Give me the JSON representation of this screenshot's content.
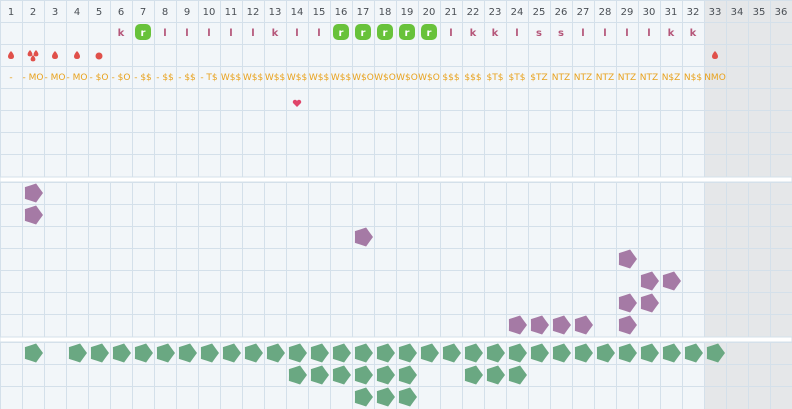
{
  "columns": [
    "1",
    "2",
    "3",
    "4",
    "5",
    "6",
    "7",
    "8",
    "9",
    "10",
    "11",
    "12",
    "13",
    "14",
    "15",
    "16",
    "17",
    "18",
    "19",
    "20",
    "21",
    "22",
    "23",
    "24",
    "25",
    "26",
    "27",
    "28",
    "29",
    "30",
    "31",
    "32",
    "33",
    "34",
    "35",
    "36"
  ],
  "letter_row": [
    {
      "col": 6,
      "text": "k"
    },
    {
      "col": 7,
      "text": "r",
      "badge": true
    },
    {
      "col": 8,
      "text": "l"
    },
    {
      "col": 9,
      "text": "l"
    },
    {
      "col": 10,
      "text": "l"
    },
    {
      "col": 11,
      "text": "l"
    },
    {
      "col": 12,
      "text": "l"
    },
    {
      "col": 13,
      "text": "k"
    },
    {
      "col": 14,
      "text": "l"
    },
    {
      "col": 15,
      "text": "l"
    },
    {
      "col": 16,
      "text": "r",
      "badge": true
    },
    {
      "col": 17,
      "text": "r",
      "badge": true
    },
    {
      "col": 18,
      "text": "r",
      "badge": true
    },
    {
      "col": 19,
      "text": "r",
      "badge": true
    },
    {
      "col": 20,
      "text": "r",
      "badge": true
    },
    {
      "col": 21,
      "text": "l"
    },
    {
      "col": 22,
      "text": "k"
    },
    {
      "col": 23,
      "text": "k"
    },
    {
      "col": 24,
      "text": "l"
    },
    {
      "col": 25,
      "text": "s"
    },
    {
      "col": 26,
      "text": "s"
    },
    {
      "col": 27,
      "text": "l"
    },
    {
      "col": 28,
      "text": "l"
    },
    {
      "col": 29,
      "text": "l"
    },
    {
      "col": 30,
      "text": "l"
    },
    {
      "col": 31,
      "text": "k"
    },
    {
      "col": 32,
      "text": "k"
    }
  ],
  "drop_row": [
    {
      "col": 1,
      "icon": "drop-icon"
    },
    {
      "col": 2,
      "icon": "double-drop-icon"
    },
    {
      "col": 3,
      "icon": "drop-icon"
    },
    {
      "col": 4,
      "icon": "drop-icon"
    },
    {
      "col": 5,
      "icon": "dot-icon"
    },
    {
      "col": 33,
      "icon": "drop-icon"
    }
  ],
  "code_row": [
    {
      "col": 1,
      "text": "-"
    },
    {
      "col": 2,
      "text": "- MO"
    },
    {
      "col": 3,
      "text": "- MO"
    },
    {
      "col": 4,
      "text": "- MO"
    },
    {
      "col": 5,
      "text": "- $O"
    },
    {
      "col": 6,
      "text": "- $O"
    },
    {
      "col": 7,
      "text": "- $$"
    },
    {
      "col": 8,
      "text": "- $$"
    },
    {
      "col": 9,
      "text": "- $$"
    },
    {
      "col": 10,
      "text": "- T$"
    },
    {
      "col": 11,
      "text": "W$$"
    },
    {
      "col": 12,
      "text": "W$$"
    },
    {
      "col": 13,
      "text": "W$$"
    },
    {
      "col": 14,
      "text": "W$$"
    },
    {
      "col": 15,
      "text": "W$$"
    },
    {
      "col": 16,
      "text": "W$$"
    },
    {
      "col": 17,
      "text": "W$O"
    },
    {
      "col": 18,
      "text": "W$O"
    },
    {
      "col": 19,
      "text": "W$O"
    },
    {
      "col": 20,
      "text": "W$O"
    },
    {
      "col": 21,
      "text": "$$$"
    },
    {
      "col": 22,
      "text": "$$$"
    },
    {
      "col": 23,
      "text": "$T$"
    },
    {
      "col": 24,
      "text": "$T$"
    },
    {
      "col": 25,
      "text": "$TZ"
    },
    {
      "col": 26,
      "text": "NTZ"
    },
    {
      "col": 27,
      "text": "NTZ"
    },
    {
      "col": 28,
      "text": "NTZ"
    },
    {
      "col": 29,
      "text": "NTZ"
    },
    {
      "col": 30,
      "text": "NTZ"
    },
    {
      "col": 31,
      "text": "N$Z"
    },
    {
      "col": 32,
      "text": "N$$"
    },
    {
      "col": 33,
      "text": "NMO"
    }
  ],
  "heart": {
    "col": 14
  },
  "purple_blobs": [
    [
      2,
      0
    ],
    [
      2,
      1
    ],
    [
      17,
      2
    ],
    [
      29,
      3
    ],
    [
      30,
      4
    ],
    [
      31,
      4
    ],
    [
      29,
      5
    ],
    [
      30,
      5
    ],
    [
      24,
      6
    ],
    [
      25,
      6
    ],
    [
      26,
      6
    ],
    [
      27,
      6
    ],
    [
      29,
      6
    ]
  ],
  "green_blobs": [
    [
      2,
      0
    ],
    [
      4,
      0
    ],
    [
      5,
      0
    ],
    [
      6,
      0
    ],
    [
      7,
      0
    ],
    [
      8,
      0
    ],
    [
      9,
      0
    ],
    [
      10,
      0
    ],
    [
      11,
      0
    ],
    [
      12,
      0
    ],
    [
      13,
      0
    ],
    [
      14,
      0
    ],
    [
      15,
      0
    ],
    [
      16,
      0
    ],
    [
      17,
      0
    ],
    [
      18,
      0
    ],
    [
      19,
      0
    ],
    [
      20,
      0
    ],
    [
      21,
      0
    ],
    [
      22,
      0
    ],
    [
      23,
      0
    ],
    [
      24,
      0
    ],
    [
      25,
      0
    ],
    [
      26,
      0
    ],
    [
      27,
      0
    ],
    [
      28,
      0
    ],
    [
      29,
      0
    ],
    [
      30,
      0
    ],
    [
      31,
      0
    ],
    [
      32,
      0
    ],
    [
      33,
      0
    ],
    [
      14,
      1
    ],
    [
      15,
      1
    ],
    [
      16,
      1
    ],
    [
      17,
      1
    ],
    [
      18,
      1
    ],
    [
      19,
      1
    ],
    [
      22,
      1
    ],
    [
      23,
      1
    ],
    [
      24,
      1
    ],
    [
      17,
      2
    ],
    [
      18,
      2
    ],
    [
      19,
      2
    ]
  ],
  "colors": {
    "background": "#f2f6f9",
    "grid_line": "#d4e0ea",
    "shaded_columns": "#e5e7e9",
    "letter": "#b5577a",
    "badge": "#68c23a",
    "drop": "#e0504a",
    "code": "#e8a21e",
    "purple": "#a57aa5",
    "green": "#6aa882",
    "heart": "#e0456a"
  }
}
